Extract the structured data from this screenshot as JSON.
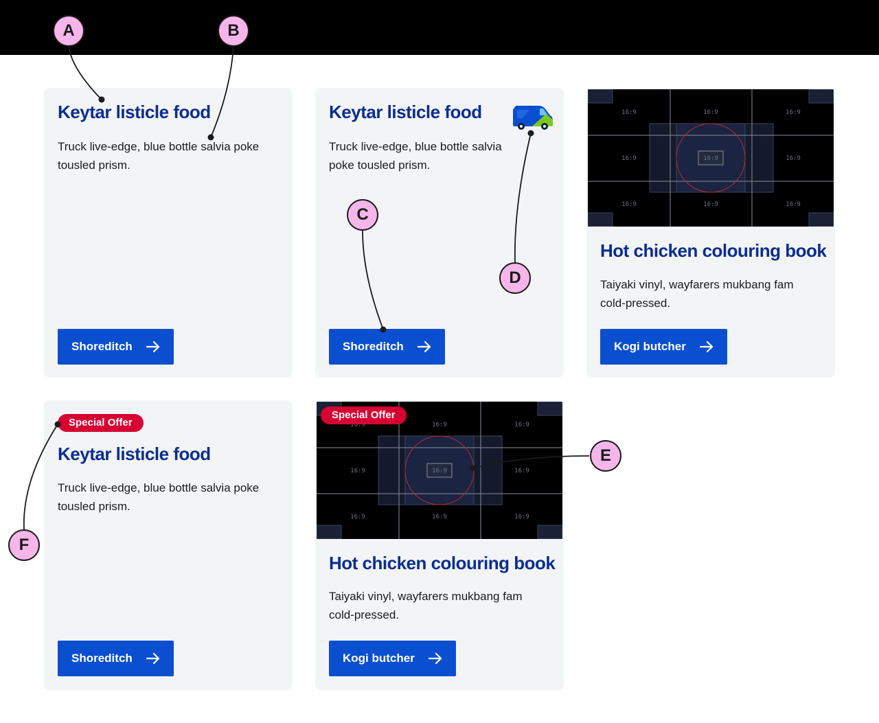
{
  "cards": [
    {
      "title": "Keytar listicle food",
      "description": "Truck live-edge, blue bottle salvia poke tousled prism.",
      "button_label": "Shoreditch"
    },
    {
      "title": "Keytar listicle food",
      "description": "Truck live-edge, blue bottle salvia poke tousled prism.",
      "button_label": "Shoreditch",
      "icon": "delivery-van-icon"
    },
    {
      "title": "Hot chicken colouring book",
      "description": "Taiyaki vinyl, wayfarers mukbang fam cold-pressed.",
      "button_label": "Kogi butcher",
      "image": "placeholder-16-9-image"
    },
    {
      "badge": "Special Offer",
      "title": "Keytar listicle food",
      "description": "Truck live-edge, blue bottle salvia poke tousled prism.",
      "button_label": "Shoreditch"
    },
    {
      "badge": "Special Offer",
      "title": "Hot chicken colouring book",
      "description": "Taiyaki vinyl, wayfarers mukbang fam cold-pressed.",
      "button_label": "Kogi butcher",
      "image": "placeholder-16-9-image"
    }
  ],
  "placeholder_label": "16:9",
  "callouts": [
    "A",
    "B",
    "C",
    "D",
    "E",
    "F"
  ],
  "colors": {
    "title": "#0a2d8f",
    "button": "#0a4fd0",
    "badge": "#d60032",
    "card_background": "#f3f4f6",
    "callout": "#f7b6ea"
  }
}
